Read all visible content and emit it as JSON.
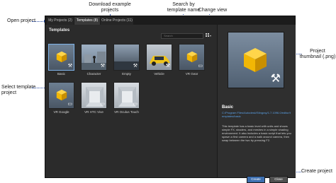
{
  "annotations": {
    "download_examples": "Download example\nprojects",
    "search_by_name": "Search by\ntemplate name",
    "change_view": "Change view",
    "open_project": "Open project",
    "project_thumbnail": "Project\nthumbnail (.png)",
    "select_template": "Select template\nproject",
    "create_project": "Create project"
  },
  "tabs": [
    {
      "label": "My Projects (2)"
    },
    {
      "label": "Templates (8)"
    },
    {
      "label": "Online Projects (11)"
    }
  ],
  "panel_title": "Templates",
  "search": {
    "placeholder": "Search"
  },
  "templates": [
    {
      "label": "Basic",
      "icon": "cube-icon"
    },
    {
      "label": "Character",
      "icon": "character-icon"
    },
    {
      "label": "Empty",
      "icon": "empty-scene-icon"
    },
    {
      "label": "Vehicle",
      "icon": "vehicle-icon"
    },
    {
      "label": "VR Gear",
      "icon": "cube-icon"
    },
    {
      "label": "VR Google",
      "icon": "cube-icon"
    },
    {
      "label": "VR HTC Vive",
      "icon": "room-icon"
    },
    {
      "label": "VR Oculus Touch",
      "icon": "room-icon"
    }
  ],
  "details": {
    "name": "Basic",
    "path": "C:/Program Files/Autodesk/Stingray/1.7.1096.0/editor/templates/basic",
    "description": "This template has a basic level with units and shows simple FX, shaders, and meshes in a simple shading environment. It also includes a basic script that lets you spawn a first camera and a walk around camera, then swap between the two by pressing F2."
  },
  "buttons": {
    "create": "Create",
    "close": "Close"
  },
  "colors": {
    "accent": "#3d6fb0",
    "link": "#5aa0e6",
    "annotation_line": "#2a4ea8",
    "cube": "#f2b705"
  }
}
